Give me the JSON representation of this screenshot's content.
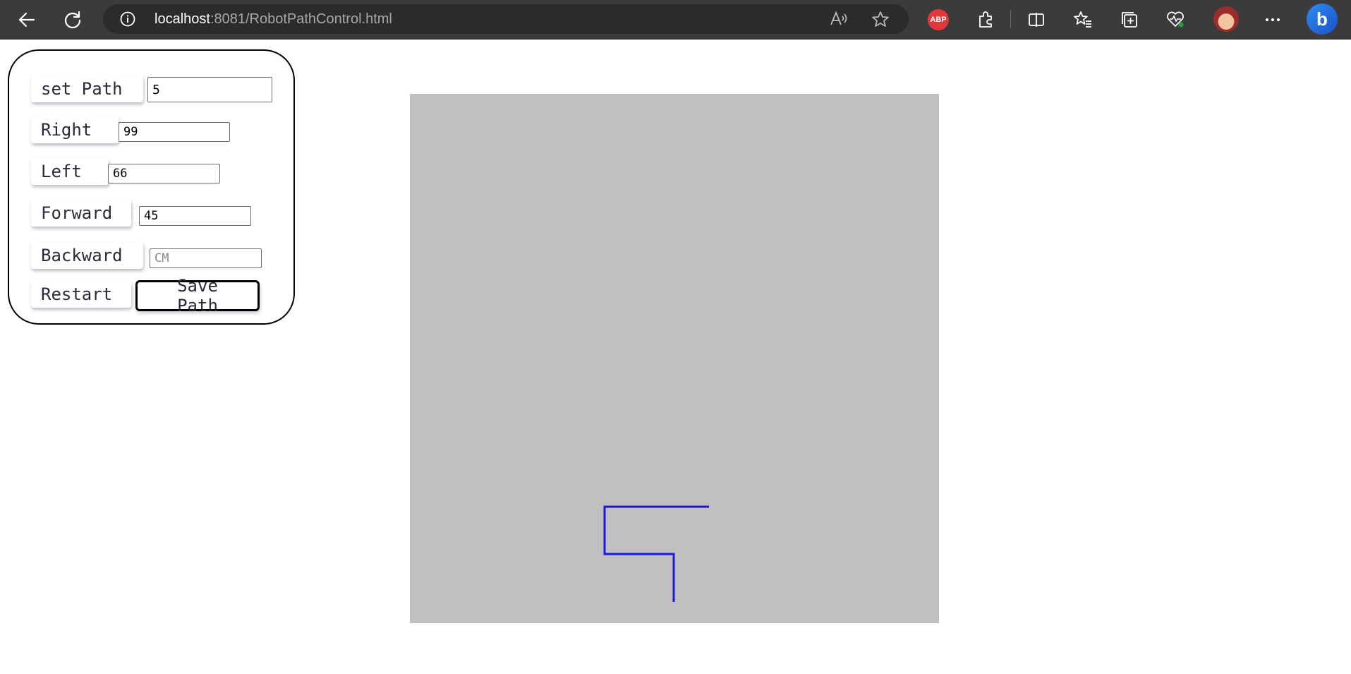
{
  "browser": {
    "url_host": "localhost",
    "url_rest": ":8081/RobotPathControl.html",
    "extension_label": "ABP",
    "bing_label": "b",
    "icons": [
      "back-icon",
      "refresh-icon",
      "info-icon",
      "read-aloud-icon",
      "favorite-star-icon",
      "adblock-icon",
      "extensions-icon",
      "split-screen-icon",
      "favorites-icon",
      "collections-icon",
      "browser-essentials-icon",
      "profile-avatar",
      "more-icon",
      "bing-chat-icon"
    ]
  },
  "controls": {
    "set_path": {
      "label": "set Path",
      "value": "5"
    },
    "right": {
      "label": "Right",
      "value": "99"
    },
    "left": {
      "label": "Left",
      "value": "66"
    },
    "forward": {
      "label": "Forward",
      "value": "45"
    },
    "backward": {
      "label": "Backward",
      "value": "",
      "placeholder": "CM"
    },
    "restart": {
      "label": "Restart"
    },
    "save_path": {
      "label": "Save Path"
    }
  },
  "canvas": {
    "background": "#c1bfc1",
    "path_color": "#1a1adc"
  }
}
